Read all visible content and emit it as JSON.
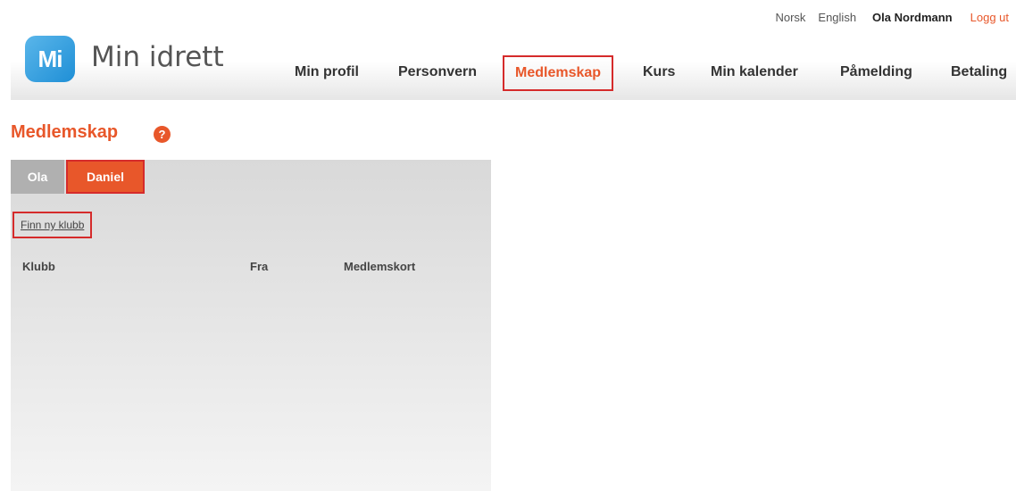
{
  "topbar": {
    "lang_no": "Norsk",
    "lang_en": "English",
    "user_name": "Ola Nordmann",
    "logout": "Logg ut"
  },
  "logo": {
    "badge": "Mi",
    "text": "Min idrett"
  },
  "nav": {
    "items": [
      {
        "label": "Min profil"
      },
      {
        "label": "Personvern"
      },
      {
        "label": "Medlemskap",
        "active": true
      },
      {
        "label": "Kurs"
      },
      {
        "label": "Min kalender"
      },
      {
        "label": "Påmelding"
      },
      {
        "label": "Betaling"
      }
    ]
  },
  "page": {
    "title": "Medlemskap",
    "help": "?"
  },
  "tabs": [
    {
      "label": "Ola"
    },
    {
      "label": "Daniel",
      "active": true
    }
  ],
  "panel": {
    "find_club_link": "Finn ny klubb",
    "columns": [
      "Klubb",
      "Fra",
      "Medlemskort"
    ]
  },
  "colors": {
    "accent": "#e8572a",
    "highlight_border": "#d52b2b",
    "logo_blue": "#2a98dc"
  }
}
